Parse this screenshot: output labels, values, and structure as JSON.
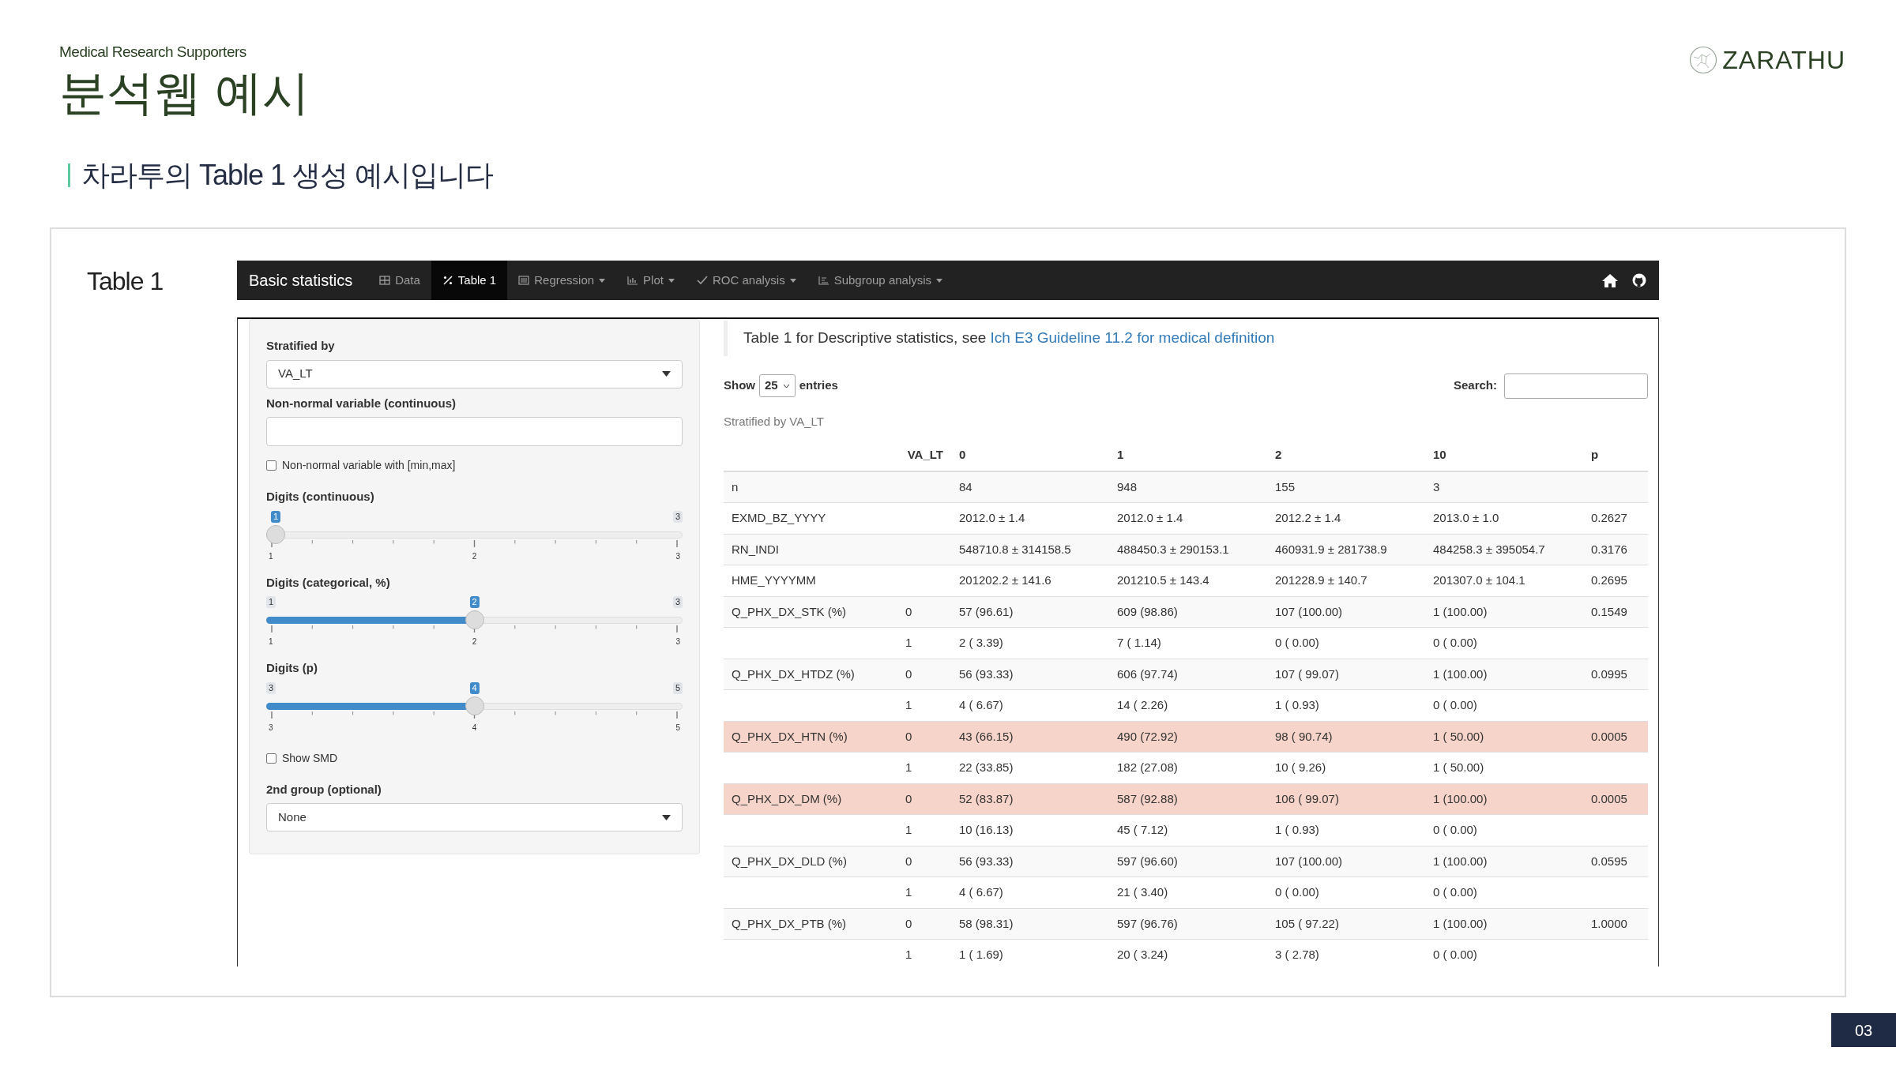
{
  "slide": {
    "kicker": "Medical Research Supporters",
    "title": "분석웹 예시",
    "logo": "ZARATHU",
    "caption": "차라투의 Table 1 생성 예시입니다",
    "panel_label": "Table 1",
    "page_number": "03"
  },
  "navbar": {
    "brand": "Basic statistics",
    "tabs": [
      {
        "label": "Data",
        "selected": false,
        "dropdown": false
      },
      {
        "label": "Table 1",
        "selected": true,
        "dropdown": false
      },
      {
        "label": "Regression",
        "selected": false,
        "dropdown": true
      },
      {
        "label": "Plot",
        "selected": false,
        "dropdown": true
      },
      {
        "label": "ROC analysis",
        "selected": false,
        "dropdown": true
      },
      {
        "label": "Subgroup analysis",
        "selected": false,
        "dropdown": true
      }
    ]
  },
  "sidebar": {
    "controls": [
      {
        "kind": "select",
        "label": "Stratified by",
        "value": "VA_LT"
      },
      {
        "kind": "text",
        "label": "Non-normal variable (continuous)"
      },
      {
        "kind": "checkbox",
        "label": "Non-normal variable with [min,max]",
        "checked": false
      },
      {
        "kind": "slider",
        "label": "Digits (continuous)",
        "max": "3",
        "value": "1",
        "level": 0,
        "ticks": [
          "1",
          "2",
          "3"
        ]
      },
      {
        "kind": "slider",
        "label": "Digits (categorical, %)",
        "min": "1",
        "max": "3",
        "value": "2",
        "level": 0.5,
        "ticks": [
          "1",
          "2",
          "3"
        ]
      },
      {
        "kind": "slider",
        "label": "Digits (p)",
        "min": "3",
        "max": "5",
        "value": "4",
        "level": 0.5,
        "ticks": [
          "3",
          "4",
          "5"
        ]
      },
      {
        "kind": "checkbox",
        "label": "Show SMD",
        "checked": false
      },
      {
        "kind": "select",
        "label": "2nd group (optional)",
        "value": "None"
      }
    ]
  },
  "main": {
    "note": "Table 1 for Descriptive statistics, see",
    "note_link": "Ich E3 Guideline 11.2 for medical definition",
    "length_before": "Show",
    "length_value": "25",
    "length_after": "entries",
    "search_label": "Search:",
    "caption": "Stratified by VA_LT",
    "table": {
      "columns": [
        "VA_LT",
        "0",
        "1",
        "2",
        "10",
        "p"
      ],
      "rows": [
        {
          "variable": "n",
          "values": [
            "84",
            "948",
            "155",
            "3"
          ],
          "highlighted": false
        },
        {
          "variable": "EXMD_BZ_YYYY",
          "values": [
            "2012.0 ± 1.4",
            "2012.0 ± 1.4",
            "2012.2 ± 1.4",
            "2013.0 ± 1.0"
          ],
          "p": "0.2627",
          "highlighted": false
        },
        {
          "variable": "RN_INDI",
          "values": [
            "548710.8 ± 314158.5",
            "488450.3 ± 290153.1",
            "460931.9 ± 281738.9",
            "484258.3 ± 395054.7"
          ],
          "p": "0.3176",
          "highlighted": false
        },
        {
          "variable": "HME_YYYYMM",
          "values": [
            "201202.2 ± 141.6",
            "201210.5 ± 143.4",
            "201228.9 ± 140.7",
            "201307.0 ± 104.1"
          ],
          "p": "0.2695",
          "highlighted": false
        },
        {
          "variable": "Q_PHX_DX_STK (%)",
          "level": "0",
          "values": [
            "57 (96.61)",
            "609 (98.86)",
            "107 (100.00)",
            "1 (100.00)"
          ],
          "p": "0.1549",
          "highlighted": false
        },
        {
          "level": "1",
          "values": [
            "2 ( 3.39)",
            "7 ( 1.14)",
            "0 ( 0.00)",
            "0 ( 0.00)"
          ],
          "highlighted": false
        },
        {
          "variable": "Q_PHX_DX_HTDZ (%)",
          "level": "0",
          "values": [
            "56 (93.33)",
            "606 (97.74)",
            "107 ( 99.07)",
            "1 (100.00)"
          ],
          "p": "0.0995",
          "highlighted": false
        },
        {
          "level": "1",
          "values": [
            "4 ( 6.67)",
            "14 ( 2.26)",
            "1 ( 0.93)",
            "0 ( 0.00)"
          ],
          "highlighted": false
        },
        {
          "variable": "Q_PHX_DX_HTN (%)",
          "level": "0",
          "values": [
            "43 (66.15)",
            "490 (72.92)",
            "98 ( 90.74)",
            "1 ( 50.00)"
          ],
          "p": "0.0005",
          "highlighted": true
        },
        {
          "level": "1",
          "values": [
            "22 (33.85)",
            "182 (27.08)",
            "10 ( 9.26)",
            "1 ( 50.00)"
          ],
          "highlighted": false
        },
        {
          "variable": "Q_PHX_DX_DM (%)",
          "level": "0",
          "values": [
            "52 (83.87)",
            "587 (92.88)",
            "106 ( 99.07)",
            "1 (100.00)"
          ],
          "p": "0.0005",
          "highlighted": true
        },
        {
          "level": "1",
          "values": [
            "10 (16.13)",
            "45 ( 7.12)",
            "1 ( 0.93)",
            "0 ( 0.00)"
          ],
          "highlighted": false
        },
        {
          "variable": "Q_PHX_DX_DLD (%)",
          "level": "0",
          "values": [
            "56 (93.33)",
            "597 (96.60)",
            "107 (100.00)",
            "1 (100.00)"
          ],
          "p": "0.0595",
          "highlighted": false
        },
        {
          "level": "1",
          "values": [
            "4 ( 6.67)",
            "21 ( 3.40)",
            "0 ( 0.00)",
            "0 ( 0.00)"
          ],
          "highlighted": false
        },
        {
          "variable": "Q_PHX_DX_PTB (%)",
          "level": "0",
          "values": [
            "58 (98.31)",
            "597 (96.76)",
            "105 ( 97.22)",
            "1 (100.00)"
          ],
          "p": "1.0000",
          "highlighted": false
        },
        {
          "level": "1",
          "values": [
            "1 ( 1.69)",
            "20 ( 3.24)",
            "3 ( 2.78)",
            "0 ( 0.00)"
          ],
          "highlighted": false
        }
      ]
    }
  }
}
